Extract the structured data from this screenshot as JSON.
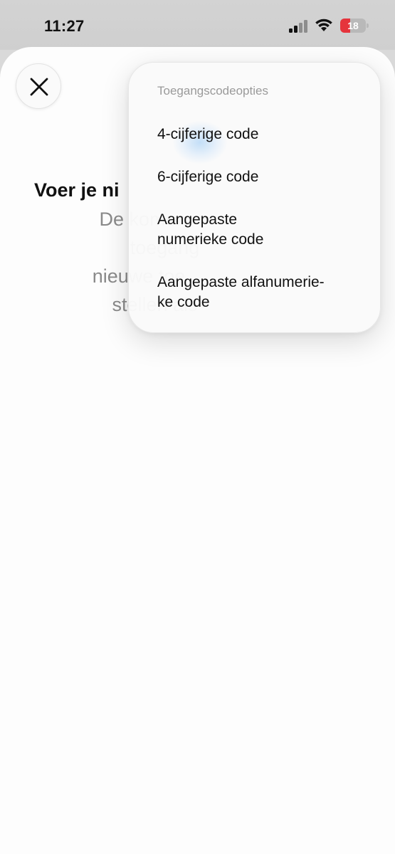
{
  "status_bar": {
    "time": "11:27",
    "battery_level": "18",
    "signal_icon": "cellular-signal-icon",
    "wifi_icon": "wifi-icon",
    "battery_icon": "battery-icon"
  },
  "sheet": {
    "close_icon": "close-icon",
    "title": "Voer je ni",
    "subtitle_lines": [
      "De komen",
      "toegang",
      "nieuwe toe",
      "stellen als"
    ]
  },
  "menu": {
    "header": "Toegangscodeopties",
    "items": [
      {
        "label_lines": [
          "4-cijferige code"
        ]
      },
      {
        "label_lines": [
          "6-cijferige code"
        ]
      },
      {
        "label_lines": [
          "Aangepaste",
          "numerieke code"
        ]
      },
      {
        "label_lines": [
          "Aangepaste alfanumerie-",
          "ke code"
        ]
      }
    ]
  },
  "colors": {
    "battery_low": "#e5343c",
    "title_text": "#111111",
    "subtitle_text": "#8a8a8a",
    "menu_header_text": "#9a9a9a"
  }
}
